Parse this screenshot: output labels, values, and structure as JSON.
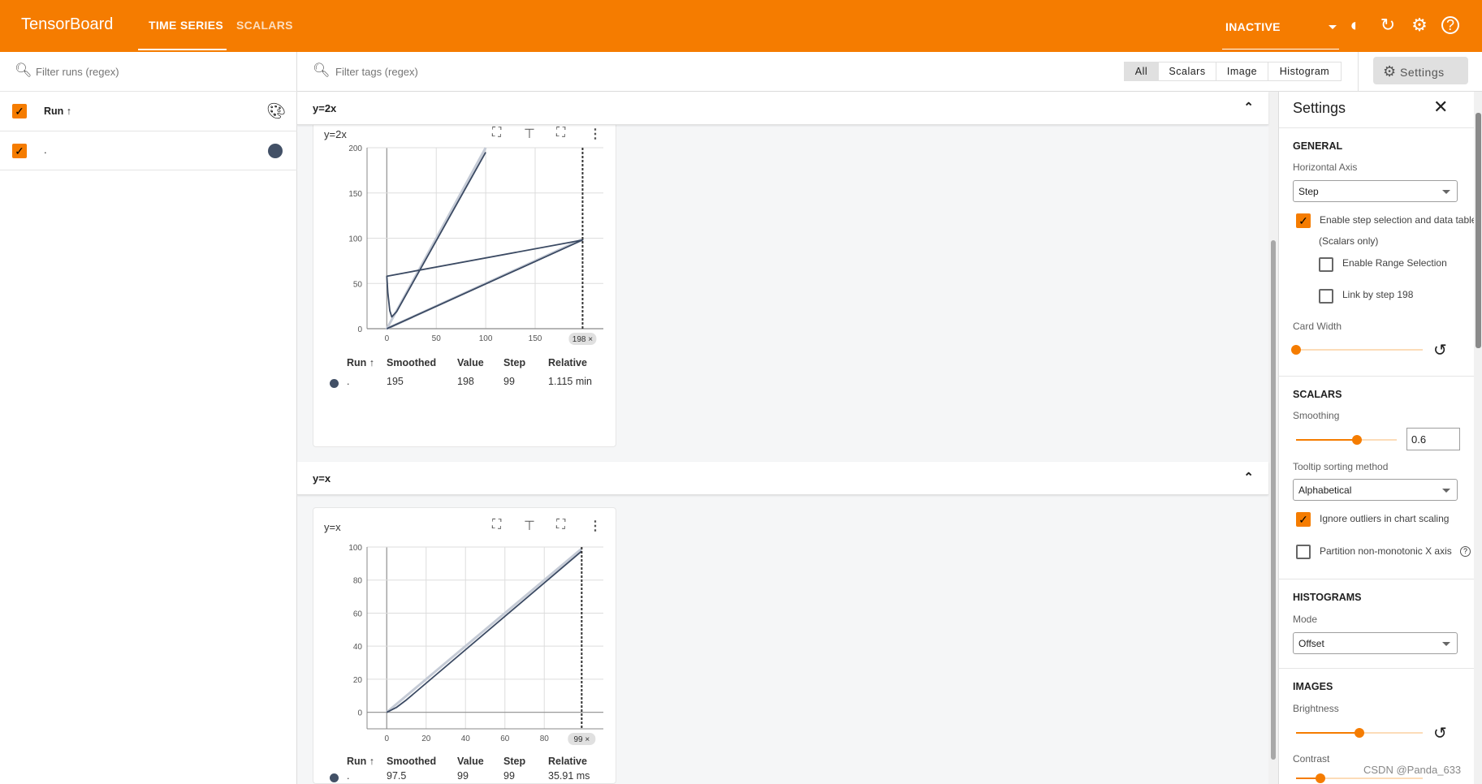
{
  "header": {
    "brand": "TensorBoard",
    "tabs": [
      {
        "label": "TIME SERIES",
        "active": true
      },
      {
        "label": "SCALARS",
        "active": false
      }
    ],
    "run_status": "INACTIVE",
    "icons": [
      "brightness-icon",
      "refresh-icon",
      "gear-icon",
      "help-icon"
    ],
    "color": "#f57c00"
  },
  "sidebar": {
    "filter_placeholder": "Filter runs (regex)",
    "header_label": "Run ↑",
    "runs": [
      {
        "name": ".",
        "color": "#425066",
        "checked": true
      }
    ]
  },
  "toolbar": {
    "filter_placeholder": "Filter tags (regex)",
    "types": [
      "All",
      "Scalars",
      "Image",
      "Histogram"
    ],
    "active_type": "All",
    "settings_label": "Settings"
  },
  "groups": [
    {
      "title": "y=2x",
      "card": {
        "title": "y=2x",
        "badge": "198 ×",
        "table": {
          "headers": [
            "Run ↑",
            "Smoothed",
            "Value",
            "Step",
            "Relative"
          ],
          "rows": [
            {
              "run": ".",
              "smoothed": "195",
              "value": "198",
              "step": "99",
              "relative": "1.115 min"
            }
          ]
        }
      }
    },
    {
      "title": "y=x",
      "card": {
        "title": "y=x",
        "badge": "99 ×",
        "table": {
          "headers": [
            "Run ↑",
            "Smoothed",
            "Value",
            "Step",
            "Relative"
          ],
          "rows": [
            {
              "run": ".",
              "smoothed": "97.5",
              "value": "99",
              "step": "99",
              "relative": "35.91 ms"
            }
          ]
        }
      }
    }
  ],
  "chart_data": [
    {
      "type": "line",
      "title": "y=2x",
      "xlim": [
        -20,
        219
      ],
      "ylim": [
        0,
        200
      ],
      "xticks": [
        0,
        50,
        100,
        150
      ],
      "yticks": [
        0,
        50,
        100,
        150,
        200
      ],
      "grid": true,
      "selected_step": 198,
      "series": [
        {
          "kind": "raw",
          "points": [
            [
              0,
              0
            ],
            [
              198,
              99
            ],
            [
              0,
              0
            ],
            [
              100,
              200
            ]
          ]
        },
        {
          "kind": "smoothed",
          "points": [
            [
              0,
              0
            ],
            [
              198,
              98
            ],
            [
              0,
              58
            ],
            [
              1,
              40
            ],
            [
              3,
              20
            ],
            [
              5,
              13
            ],
            [
              10,
              19
            ],
            [
              100,
              195
            ]
          ]
        }
      ]
    },
    {
      "type": "line",
      "title": "y=x",
      "xlim": [
        -10,
        110
      ],
      "ylim": [
        -10,
        100
      ],
      "xticks": [
        0,
        20,
        40,
        60,
        80
      ],
      "yticks": [
        0,
        20,
        40,
        60,
        80,
        100
      ],
      "grid": true,
      "selected_step": 99,
      "series": [
        {
          "kind": "raw",
          "points": [
            [
              0,
              0
            ],
            [
              99,
              99
            ]
          ]
        },
        {
          "kind": "smoothed",
          "points": [
            [
              0,
              0
            ],
            [
              5,
              3
            ],
            [
              10,
              7.5
            ],
            [
              99,
              97.5
            ]
          ]
        }
      ]
    }
  ],
  "settings": {
    "title": "Settings",
    "general": {
      "heading": "GENERAL",
      "horizontal_axis_label": "Horizontal Axis",
      "horizontal_axis": "Step",
      "enable_step_selection": "Enable step selection and data table",
      "scalars_only": "(Scalars only)",
      "enable_range": "Enable Range Selection",
      "link_by_step": "Link by step 198",
      "card_width_label": "Card Width",
      "card_width": 0
    },
    "scalars": {
      "heading": "SCALARS",
      "smoothing_label": "Smoothing",
      "smoothing": "0.6",
      "tooltip_label": "Tooltip sorting method",
      "tooltip_sort": "Alphabetical",
      "ignore_outliers": "Ignore outliers in chart scaling",
      "partition": "Partition non-monotonic X axis"
    },
    "histograms": {
      "heading": "HISTOGRAMS",
      "mode_label": "Mode",
      "mode": "Offset"
    },
    "images": {
      "heading": "IMAGES",
      "brightness_label": "Brightness",
      "brightness": 0.5,
      "contrast_label": "Contrast",
      "contrast": 0.2
    }
  },
  "watermark": "CSDN @Panda_633"
}
